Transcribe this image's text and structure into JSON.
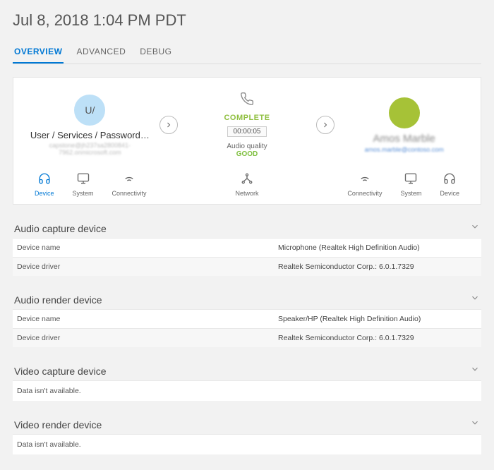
{
  "title": "Jul 8, 2018 1:04 PM PDT",
  "tabs": {
    "overview": "OVERVIEW",
    "advanced": "ADVANCED",
    "debug": "DEBUG"
  },
  "caller": {
    "avatar_initials": "U/",
    "name": "User / Services / Password…",
    "sub": "capstone@jh237sa2800841-7962.onmicrosoft.com"
  },
  "callee": {
    "name": "Amos Marble",
    "sub": "amos.marble@contoso.com"
  },
  "center": {
    "status": "COMPLETE",
    "duration": "00:00:05",
    "aq_label": "Audio quality",
    "aq_value": "GOOD"
  },
  "icons_left": {
    "device": "Device",
    "system": "System",
    "connectivity": "Connectivity"
  },
  "icons_center": {
    "network": "Network"
  },
  "icons_right": {
    "connectivity": "Connectivity",
    "system": "System",
    "device": "Device"
  },
  "sections": {
    "audio_capture": {
      "title": "Audio capture device",
      "rows": [
        {
          "k": "Device name",
          "v": "Microphone (Realtek High Definition Audio)"
        },
        {
          "k": "Device driver",
          "v": "Realtek Semiconductor Corp.: 6.0.1.7329"
        }
      ]
    },
    "audio_render": {
      "title": "Audio render device",
      "rows": [
        {
          "k": "Device name",
          "v": "Speaker/HP (Realtek High Definition Audio)"
        },
        {
          "k": "Device driver",
          "v": "Realtek Semiconductor Corp.: 6.0.1.7329"
        }
      ]
    },
    "video_capture": {
      "title": "Video capture device",
      "msg": "Data isn't available."
    },
    "video_render": {
      "title": "Video render device",
      "msg": "Data isn't available."
    }
  }
}
